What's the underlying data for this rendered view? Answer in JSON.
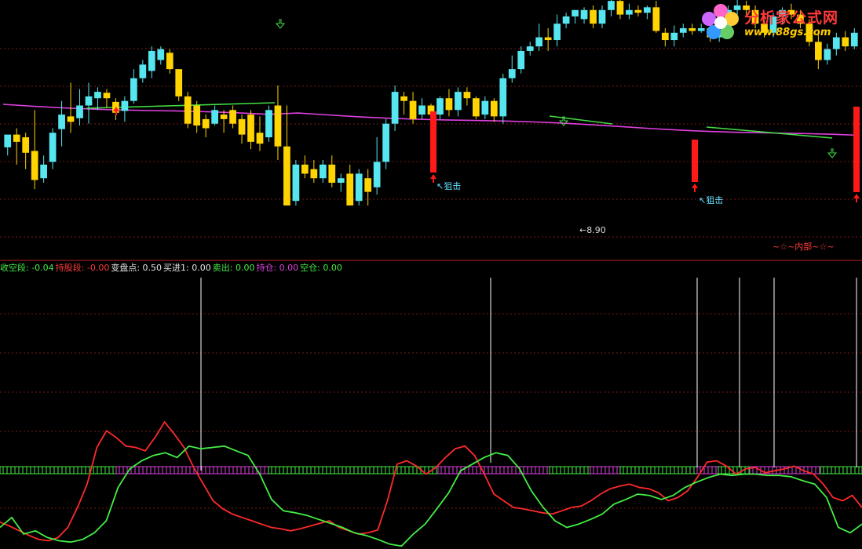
{
  "logo": {
    "name": "分析家公式网",
    "url": "www.88gs.com"
  },
  "colors": {
    "up": "#55e6f0",
    "down": "#ffd400",
    "signal": "#ff1a1a",
    "ma_pink": "#e040e0",
    "ma_green": "#44dd44",
    "red_line": "#ff2a2a",
    "green_line": "#44ee44",
    "grid": "#7a1a1a",
    "text_white": "#e6e6e6"
  },
  "annotations": {
    "snipe1": "↖狙击",
    "snipe2": "↖狙击",
    "low": "←8.90",
    "internal": "~☆~内部~☆~"
  },
  "legend": [
    {
      "label": "收空段:",
      "value": "-0.04",
      "color": "#44ee44"
    },
    {
      "label": "持股段:",
      "value": "-0.00",
      "color": "#ff3b3b"
    },
    {
      "label": "变盘点:",
      "value": "0.50",
      "color": "#e6e6e6"
    },
    {
      "label": "买进1:",
      "value": "0.00",
      "color": "#e6e6e6"
    },
    {
      "label": "卖出:",
      "value": "0.00",
      "color": "#44ee44"
    },
    {
      "label": "持仓:",
      "value": "0.00",
      "color": "#e040e0"
    },
    {
      "label": "空仓:",
      "value": "0.00",
      "color": "#44ee44"
    }
  ],
  "chart_data": [
    {
      "type": "candlestick",
      "xlabel": "",
      "ylabel": "",
      "grid": true,
      "candles_y_px_note": "",
      "candles": [
        [
          0,
          64,
          78,
          55,
          68
        ],
        [
          1,
          78,
          70,
          45,
          85
        ],
        [
          2,
          75,
          58,
          40,
          80
        ],
        [
          3,
          60,
          28,
          18,
          105
        ],
        [
          4,
          30,
          45,
          25,
          55
        ],
        [
          5,
          48,
          80,
          40,
          85
        ],
        [
          6,
          84,
          100,
          65,
          115
        ],
        [
          7,
          98,
          92,
          80,
          135
        ],
        [
          8,
          96,
          110,
          88,
          128
        ],
        [
          9,
          110,
          120,
          90,
          135
        ],
        [
          10,
          118,
          125,
          105,
          130
        ],
        [
          11,
          124,
          118,
          108,
          128
        ],
        [
          12,
          114,
          102,
          94,
          118
        ],
        [
          13,
          104,
          115,
          92,
          120
        ],
        [
          14,
          115,
          140,
          112,
          150
        ],
        [
          15,
          140,
          155,
          135,
          160
        ],
        [
          16,
          148,
          170,
          140,
          175
        ],
        [
          17,
          160,
          172,
          155,
          175
        ],
        [
          18,
          168,
          150,
          145,
          172
        ],
        [
          19,
          150,
          120,
          115,
          130
        ],
        [
          20,
          120,
          90,
          85,
          125
        ],
        [
          21,
          110,
          88,
          80,
          115
        ],
        [
          22,
          95,
          85,
          75,
          100
        ],
        [
          23,
          90,
          105,
          88,
          110
        ],
        [
          24,
          100,
          95,
          80,
          105
        ],
        [
          25,
          105,
          90,
          85,
          110
        ],
        [
          26,
          95,
          78,
          68,
          100
        ],
        [
          27,
          100,
          70,
          62,
          105
        ],
        [
          28,
          80,
          68,
          60,
          98
        ],
        [
          29,
          75,
          105,
          70,
          110
        ],
        [
          30,
          110,
          65,
          50,
          132
        ],
        [
          31,
          65,
          0,
          0,
          110
        ],
        [
          32,
          5,
          45,
          0,
          50
        ],
        [
          33,
          45,
          35,
          30,
          55
        ],
        [
          34,
          40,
          30,
          25,
          50
        ],
        [
          35,
          30,
          45,
          25,
          50
        ],
        [
          36,
          45,
          25,
          20,
          55
        ],
        [
          37,
          25,
          30,
          15,
          35
        ],
        [
          38,
          35,
          0,
          0,
          45
        ],
        [
          39,
          5,
          35,
          0,
          40
        ],
        [
          40,
          30,
          15,
          0,
          40
        ],
        [
          41,
          20,
          48,
          12,
          75
        ],
        [
          42,
          48,
          90,
          40,
          95
        ],
        [
          43,
          90,
          125,
          82,
          132
        ],
        [
          44,
          120,
          115,
          100,
          125
        ],
        [
          45,
          115,
          95,
          90,
          125
        ],
        [
          46,
          100,
          110,
          95,
          118
        ],
        [
          47,
          110,
          100,
          92,
          112
        ],
        [
          48,
          100,
          118,
          95,
          120
        ],
        [
          49,
          118,
          105,
          98,
          128
        ],
        [
          50,
          105,
          125,
          98,
          130
        ],
        [
          51,
          125,
          118,
          110,
          130
        ],
        [
          52,
          118,
          98,
          95,
          120
        ],
        [
          53,
          100,
          115,
          95,
          120
        ],
        [
          54,
          115,
          98,
          92,
          118
        ],
        [
          55,
          98,
          140,
          90,
          145
        ],
        [
          56,
          140,
          150,
          135,
          165
        ],
        [
          57,
          150,
          170,
          145,
          175
        ],
        [
          58,
          170,
          175,
          165,
          180
        ],
        [
          59,
          175,
          185,
          170,
          200
        ],
        [
          60,
          185,
          182,
          170,
          195
        ],
        [
          61,
          182,
          200,
          175,
          210
        ],
        [
          62,
          200,
          208,
          195,
          212
        ],
        [
          63,
          208,
          215,
          200,
          215
        ],
        [
          64,
          205,
          215,
          200,
          218
        ],
        [
          65,
          215,
          200,
          195,
          220
        ],
        [
          66,
          200,
          215,
          195,
          220
        ],
        [
          67,
          215,
          225,
          208,
          228
        ],
        [
          68,
          225,
          210,
          205,
          230
        ],
        [
          69,
          210,
          215,
          205,
          222
        ],
        [
          70,
          215,
          212,
          208,
          220
        ],
        [
          71,
          212,
          218,
          205,
          220
        ],
        [
          72,
          218,
          192,
          190,
          225
        ],
        [
          73,
          190,
          182,
          175,
          195
        ],
        [
          74,
          182,
          190,
          175,
          198
        ],
        [
          75,
          190,
          195,
          185,
          200
        ],
        [
          76,
          195,
          192,
          188,
          200
        ],
        [
          77,
          192,
          195,
          190,
          200
        ],
        [
          78,
          195,
          185,
          180,
          200
        ],
        [
          79,
          185,
          192,
          180,
          195
        ],
        [
          80,
          192,
          215,
          185,
          220
        ],
        [
          81,
          215,
          220,
          210,
          228
        ],
        [
          82,
          220,
          215,
          210,
          225
        ],
        [
          83,
          215,
          200,
          195,
          220
        ],
        [
          84,
          200,
          190,
          185,
          205
        ],
        [
          85,
          190,
          208,
          185,
          212
        ],
        [
          86,
          208,
          215,
          200,
          218
        ],
        [
          87,
          215,
          210,
          205,
          222
        ],
        [
          88,
          210,
          200,
          195,
          215
        ],
        [
          89,
          200,
          180,
          175,
          205
        ],
        [
          90,
          180,
          160,
          150,
          190
        ],
        [
          91,
          160,
          172,
          155,
          178
        ],
        [
          92,
          172,
          185,
          165,
          190
        ],
        [
          93,
          185,
          175,
          170,
          192
        ],
        [
          94,
          175,
          190,
          172,
          195
        ]
      ],
      "ma_pink": [
        95,
        94,
        93,
        92,
        92,
        91,
        91,
        90,
        90,
        90,
        90,
        90,
        90,
        90,
        90,
        90,
        90,
        90,
        90,
        90,
        90,
        90,
        90,
        90,
        90,
        90,
        91,
        92,
        93,
        94
      ],
      "ma_green_segments": "overlap"
    },
    {
      "type": "line",
      "series": [
        {
          "name": "",
          "color": "#ff2a2a",
          "values": [
            38,
            32,
            25,
            18,
            12,
            10,
            15,
            30,
            60,
            95,
            150,
            175,
            165,
            152,
            150,
            145,
            165,
            188,
            170,
            150,
            120,
            95,
            70,
            58,
            50,
            45,
            40,
            35,
            30,
            28,
            25,
            28,
            32,
            36,
            40,
            30,
            25,
            20,
            22,
            26,
            70,
            125,
            130,
            122,
            110,
            120,
            135,
            148,
            152,
            138,
            110,
            80,
            70,
            60,
            58,
            55,
            52,
            50,
            55,
            60,
            62,
            70,
            80,
            88,
            92,
            95,
            90,
            88,
            82,
            70,
            75,
            85,
            105,
            128,
            130,
            122,
            110,
            118,
            120,
            112,
            115,
            118,
            122,
            115,
            110,
            95,
            75,
            70,
            78,
            60
          ]
        },
        {
          "name": "",
          "color": "#44ee44",
          "values": [
            30,
            45,
            20,
            25,
            15,
            10,
            8,
            12,
            22,
            40,
            90,
            118,
            130,
            138,
            142,
            135,
            152,
            148,
            150,
            152,
            145,
            138,
            110,
            72,
            55,
            52,
            48,
            42,
            36,
            30,
            22,
            18,
            12,
            5,
            2,
            20,
            35,
            58,
            82,
            115,
            125,
            135,
            142,
            138,
            118,
            85,
            60,
            40,
            30,
            35,
            42,
            50,
            65,
            72,
            80,
            78,
            72,
            78,
            90,
            98,
            105,
            110,
            108,
            110,
            110,
            108,
            108,
            106,
            100,
            95,
            75,
            30,
            22,
            35
          ]
        }
      ],
      "baseline_strip": true
    }
  ]
}
